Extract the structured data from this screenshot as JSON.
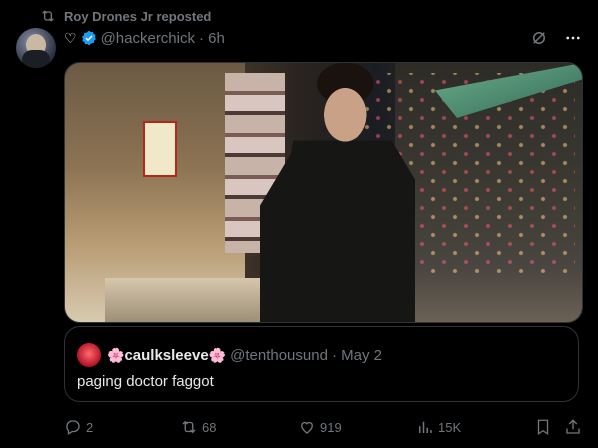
{
  "repost": {
    "text": "Roy Drones Jr reposted",
    "icon": "repost-icon"
  },
  "post": {
    "heart": "♡",
    "handle": "@hackerchick",
    "time": "· 6h",
    "icons": [
      "grok-icon",
      "more-icon"
    ]
  },
  "media": {
    "description_icon": "photo"
  },
  "quote": {
    "flower_left": "🌸",
    "name": "caulksleeve",
    "flower_right": "🌸",
    "handle": "@tenthousund",
    "date": "· May 2",
    "text": "paging doctor faggot"
  },
  "actions": {
    "replies": "2",
    "reposts": "68",
    "likes": "919",
    "views": "15K"
  },
  "colors": {
    "background": "#000000",
    "text": "#e7e9ea",
    "muted": "#71767b",
    "border": "#2f3336",
    "verified": "#1d9bf0"
  }
}
